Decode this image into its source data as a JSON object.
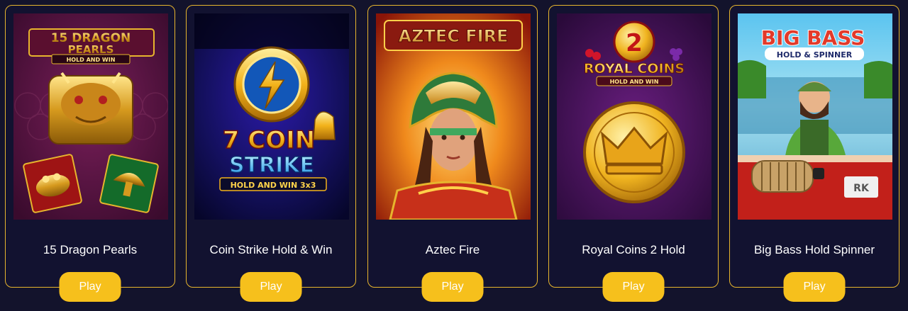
{
  "games": [
    {
      "title": "15 Dragon Pearls",
      "play_label": "Play",
      "logo": {
        "line1": "15 DRAGON",
        "line2": "PEARLS",
        "line3": "HOLD AND WIN"
      }
    },
    {
      "title": "Coin Strike Hold & Win",
      "play_label": "Play",
      "logo": {
        "line1": "7 COIN",
        "line2": "STRIKE",
        "line3": "HOLD AND WIN 3x3"
      }
    },
    {
      "title": "Aztec Fire",
      "play_label": "Play",
      "logo": {
        "line1": "AZTEC FIRE"
      }
    },
    {
      "title": "Royal Coins 2 Hold",
      "play_label": "Play",
      "logo": {
        "line1": "2",
        "line2": "ROYAL COINS",
        "line3": "HOLD AND WIN"
      }
    },
    {
      "title": "Big Bass Hold Spinner",
      "play_label": "Play",
      "logo": {
        "line1": "BIG BASS",
        "line2": "HOLD & SPINNER",
        "line3": "RK"
      }
    }
  ],
  "colors": {
    "background": "#13132c",
    "card_border": "#e7b52d",
    "play_button": "#f6c01c"
  }
}
